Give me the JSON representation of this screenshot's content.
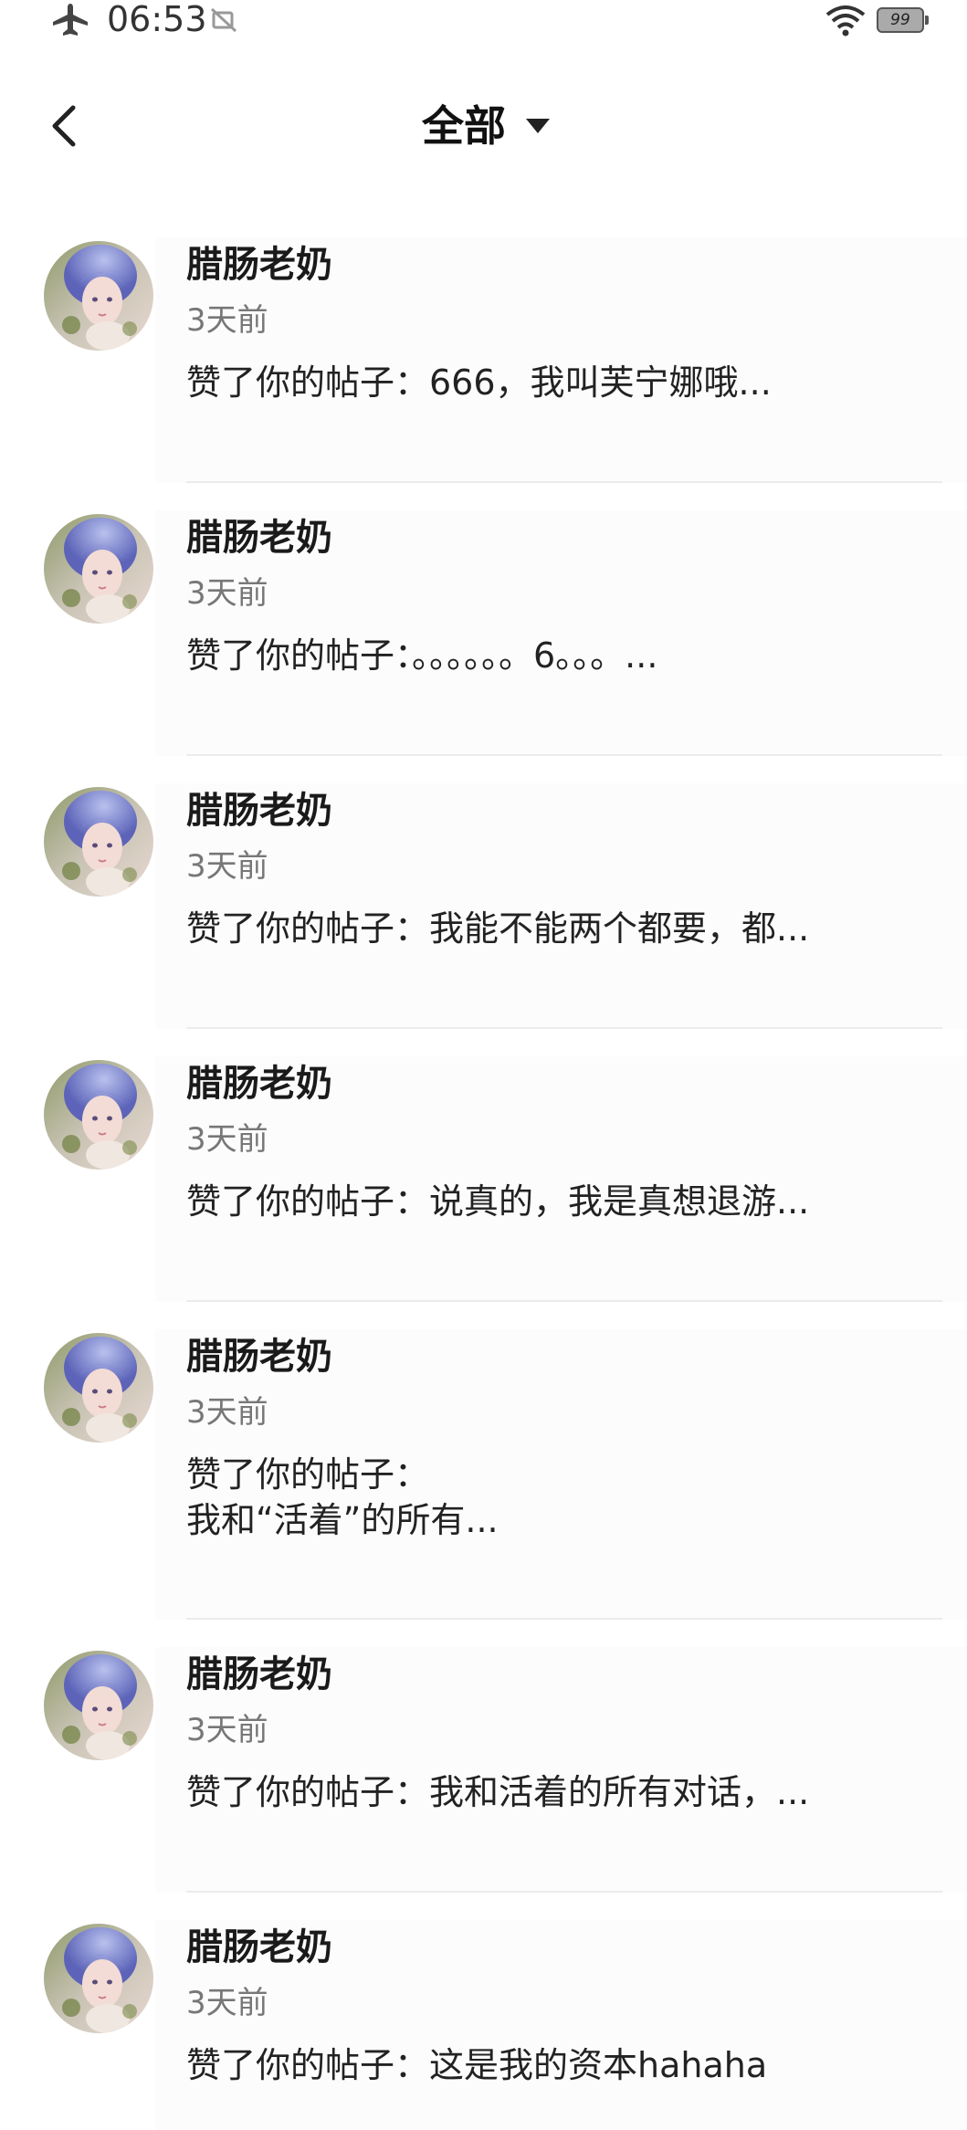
{
  "status_bar": {
    "time": "06:53",
    "battery": "99"
  },
  "header": {
    "filter_label": "全部"
  },
  "notifications": [
    {
      "name": "腊肠老奶",
      "time": "3天前",
      "message": "赞了你的帖子：666，我叫芙宁娜哦..."
    },
    {
      "name": "腊肠老奶",
      "time": "3天前",
      "message": "赞了你的帖子：。。。。。。6。。。..."
    },
    {
      "name": "腊肠老奶",
      "time": "3天前",
      "message": "赞了你的帖子：我能不能两个都要，都..."
    },
    {
      "name": "腊肠老奶",
      "time": "3天前",
      "message": "赞了你的帖子：说真的，我是真想退游..."
    },
    {
      "name": "腊肠老奶",
      "time": "3天前",
      "message": "赞了你的帖子：\n我和“活着”的所有..."
    },
    {
      "name": "腊肠老奶",
      "time": "3天前",
      "message": "赞了你的帖子：我和活着的所有对话，..."
    },
    {
      "name": "腊肠老奶",
      "time": "3天前",
      "message": "赞了你的帖子：这是我的资本hahaha"
    }
  ]
}
